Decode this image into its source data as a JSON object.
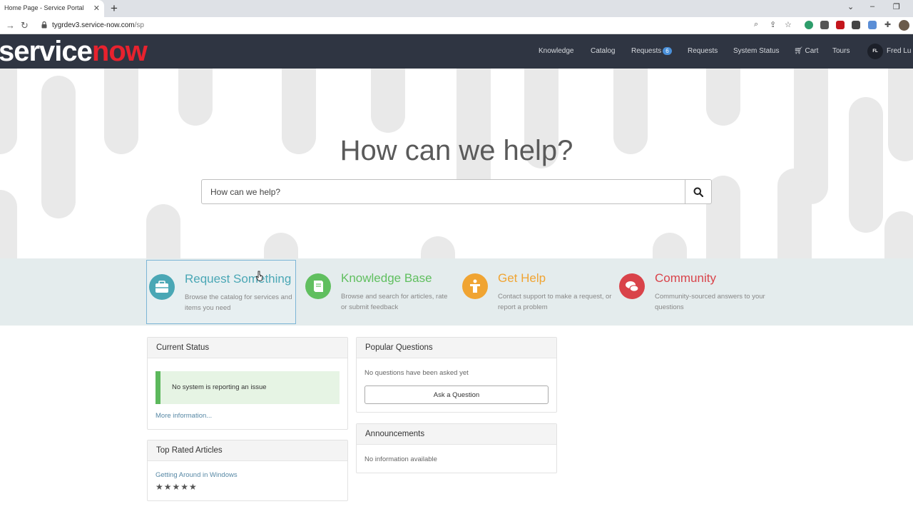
{
  "browser": {
    "tab_title": "Home Page - Service Portal",
    "url_host": "tygrdev3.service-now.com",
    "url_path": "/sp"
  },
  "header": {
    "logo_part1": "service",
    "logo_part2": "now",
    "nav": [
      "Knowledge",
      "Catalog",
      "Requests",
      "Requests",
      "System Status",
      "Cart",
      "Tours"
    ],
    "requests_badge": "6",
    "user_initials": "FL",
    "user_name": "Fred Lu"
  },
  "hero": {
    "title": "How can we help?",
    "search_placeholder": "How can we help?"
  },
  "quick_links": [
    {
      "title": "Request Something",
      "desc": "Browse the catalog for services and items you need",
      "color": "#4aa7b5",
      "icon": "briefcase-icon"
    },
    {
      "title": "Knowledge Base",
      "desc": "Browse and search for articles, rate or submit feedback",
      "color": "#60bf5f",
      "icon": "book-icon"
    },
    {
      "title": "Get Help",
      "desc": "Contact support to make a request, or report a problem",
      "color": "#f0a432",
      "icon": "help-icon"
    },
    {
      "title": "Community",
      "desc": "Community-sourced answers to your questions",
      "color": "#d9434a",
      "icon": "chat-icon"
    }
  ],
  "current_status": {
    "title": "Current Status",
    "message": "No system is reporting an issue",
    "more_link": "More information..."
  },
  "popular_questions": {
    "title": "Popular Questions",
    "empty": "No questions have been asked yet",
    "button": "Ask a Question"
  },
  "announcements": {
    "title": "Announcements",
    "empty": "No information available"
  },
  "top_rated": {
    "title": "Top Rated Articles",
    "article": "Getting Around in Windows",
    "rating": "★★★★★"
  }
}
